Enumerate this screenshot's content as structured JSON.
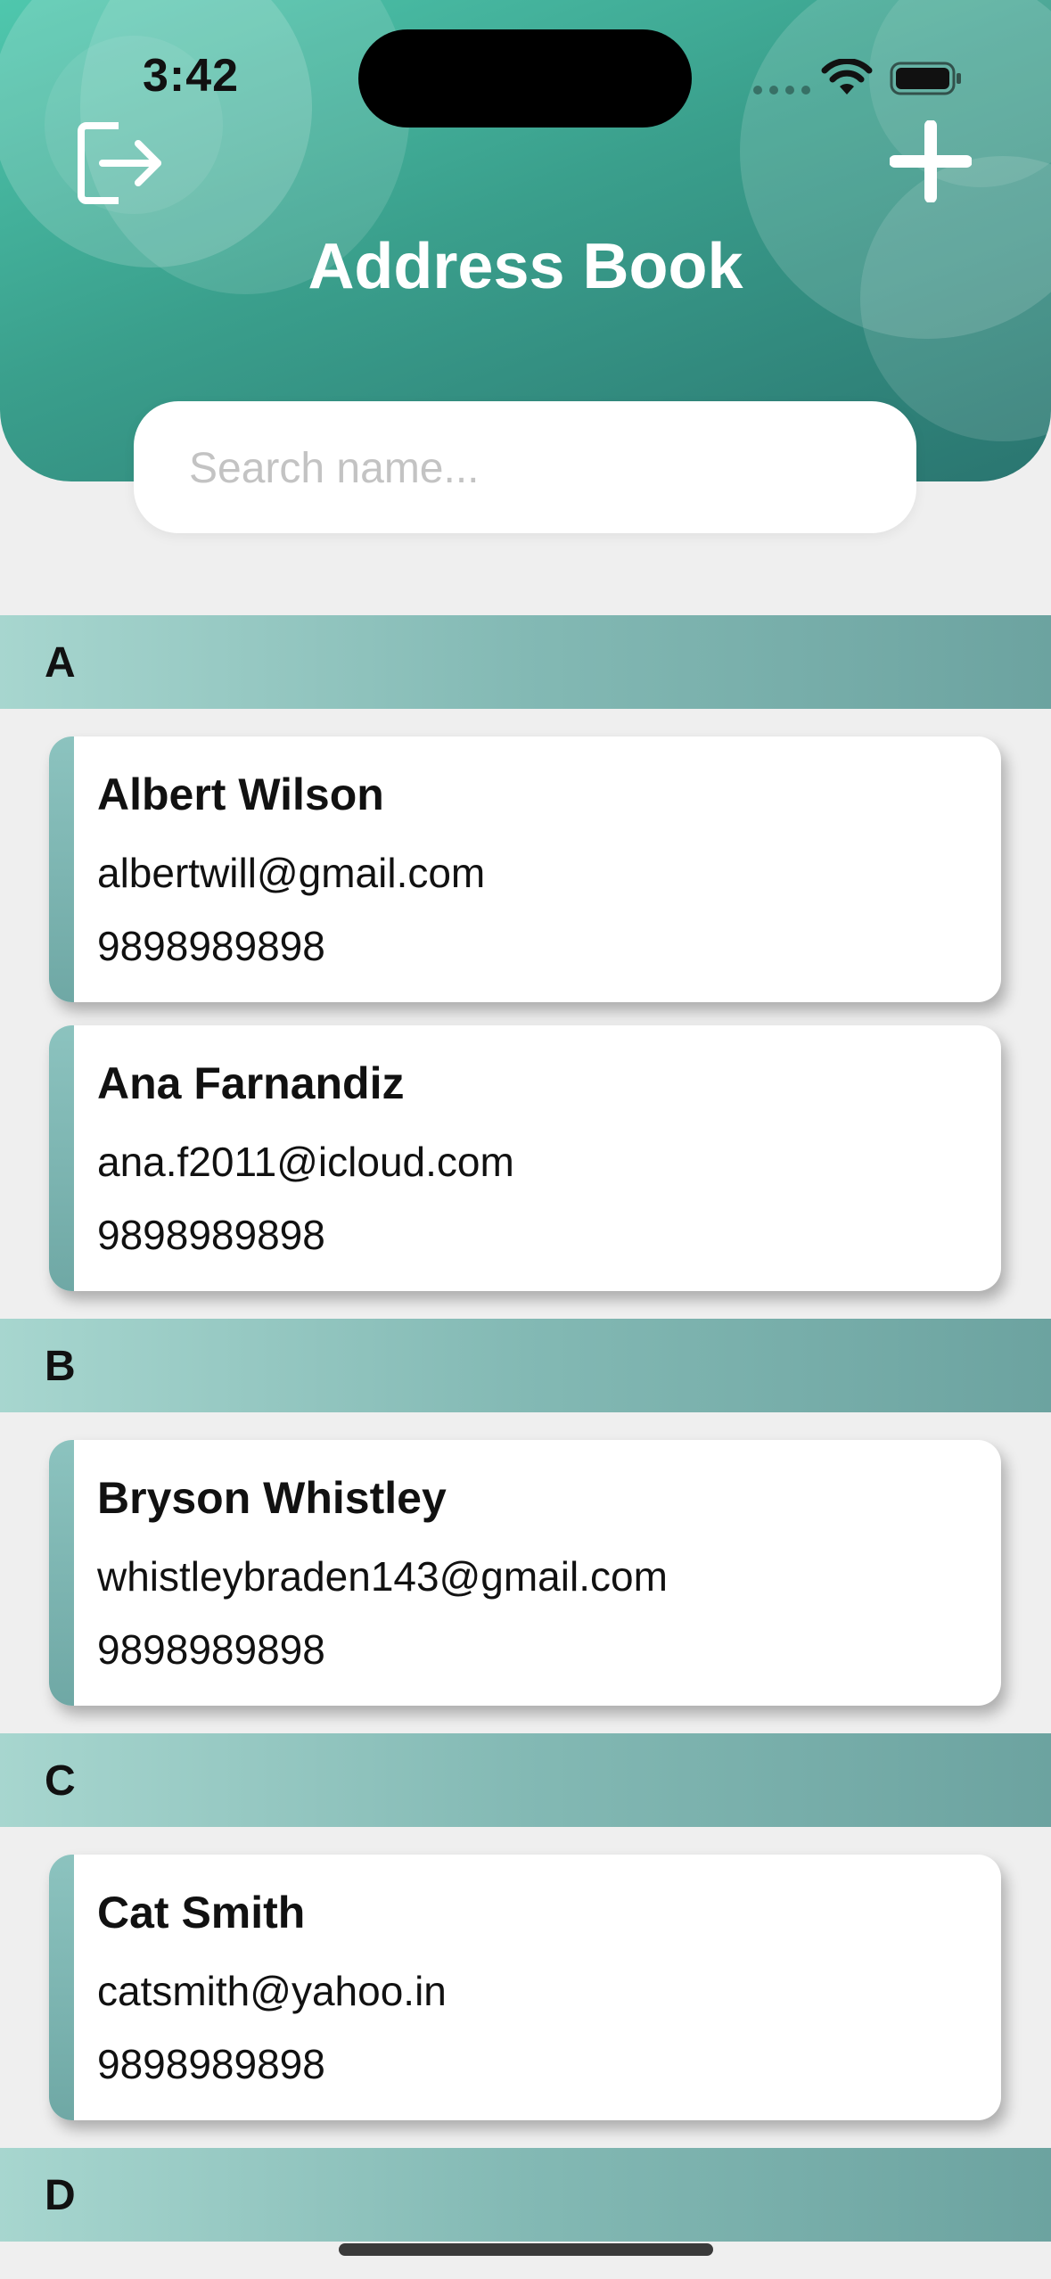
{
  "status_bar": {
    "time": "3:42"
  },
  "header": {
    "title": "Address Book",
    "logout_icon": "logout-icon",
    "add_icon": "plus-icon",
    "gradient_colors": [
      "#4fc7ad",
      "#3a9f8c",
      "#2a7570"
    ]
  },
  "search": {
    "placeholder": "Search name...",
    "value": ""
  },
  "sections": [
    {
      "letter": "A",
      "contacts": [
        {
          "name": "Albert Wilson",
          "email": "albertwill@gmail.com",
          "phone": "9898989898"
        },
        {
          "name": "Ana Farnandiz",
          "email": "ana.f2011@icloud.com",
          "phone": "9898989898"
        }
      ]
    },
    {
      "letter": "B",
      "contacts": [
        {
          "name": "Bryson Whistley",
          "email": "whistleybraden143@gmail.com",
          "phone": "9898989898"
        }
      ]
    },
    {
      "letter": "C",
      "contacts": [
        {
          "name": "Cat Smith",
          "email": "catsmith@yahoo.in",
          "phone": "9898989898"
        }
      ]
    },
    {
      "letter": "D",
      "contacts": []
    }
  ],
  "colors": {
    "background": "#efefef",
    "section_header": "#83b9b4",
    "card_accent": "#7fb6b2"
  }
}
